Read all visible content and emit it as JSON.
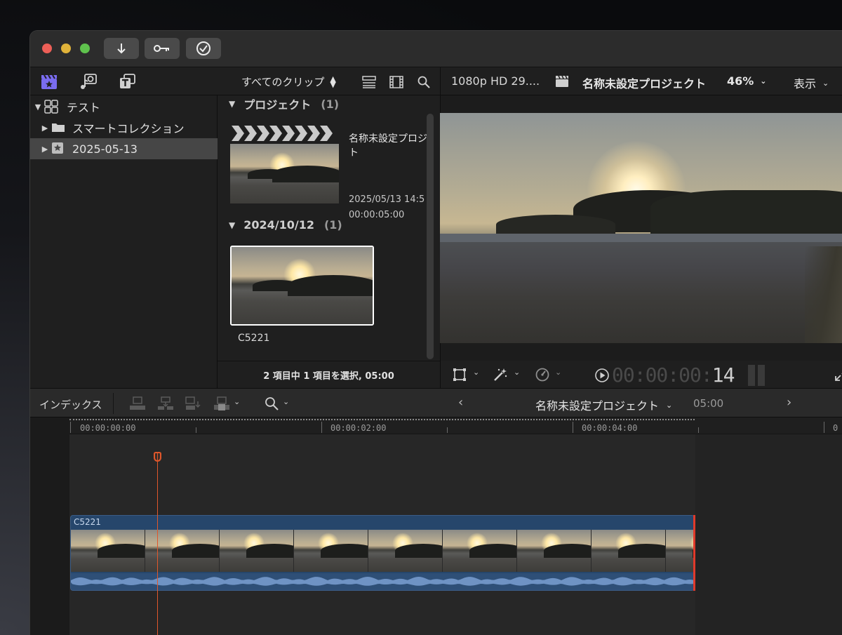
{
  "toolbar": {
    "import_icon": "download-arrow-icon",
    "keyword_icon": "key-icon",
    "check_icon": "checkmark-circle-icon"
  },
  "library": {
    "items": [
      {
        "label": "テスト",
        "icon": "library-grid-icon",
        "expanded": true
      },
      {
        "label": "スマートコレクション",
        "icon": "folder-icon",
        "expanded": false
      },
      {
        "label": "2025-05-13",
        "icon": "star-event-icon",
        "expanded": false,
        "selected": true
      }
    ]
  },
  "browser": {
    "filter_label": "すべてのクリップ",
    "sections": [
      {
        "title": "プロジェクト",
        "count": "(1)"
      },
      {
        "title": "2024/10/12",
        "count": "(1)"
      }
    ],
    "project_item": {
      "name_line1": "名称未設定プロジ",
      "name_line2": "ト",
      "date": "2025/05/13 14:5",
      "duration": "00:00:05:00"
    },
    "clip_item": {
      "name": "C5221"
    },
    "status": "2 項目中 1 項目を選択, 05:00"
  },
  "viewer": {
    "format": "1080p HD 29....",
    "project_name": "名称未設定プロジェクト",
    "zoom": "46%",
    "view_label": "表示",
    "timecode_dim": "00:00:00:",
    "timecode_frames": "14"
  },
  "timeline": {
    "index_label": "インデックス",
    "project_name": "名称未設定プロジェクト",
    "duration": "05:00",
    "ruler_labels": [
      "00:00:00:00",
      "00:00:02:00",
      "00:00:04:00"
    ],
    "clip_name": "C5221"
  },
  "colors": {
    "window_bg": "#1f1f1f",
    "accent_purple": "#7a6cf0",
    "clip_blue": "#26466b",
    "playhead": "#e0572b",
    "selection": "#464646"
  }
}
